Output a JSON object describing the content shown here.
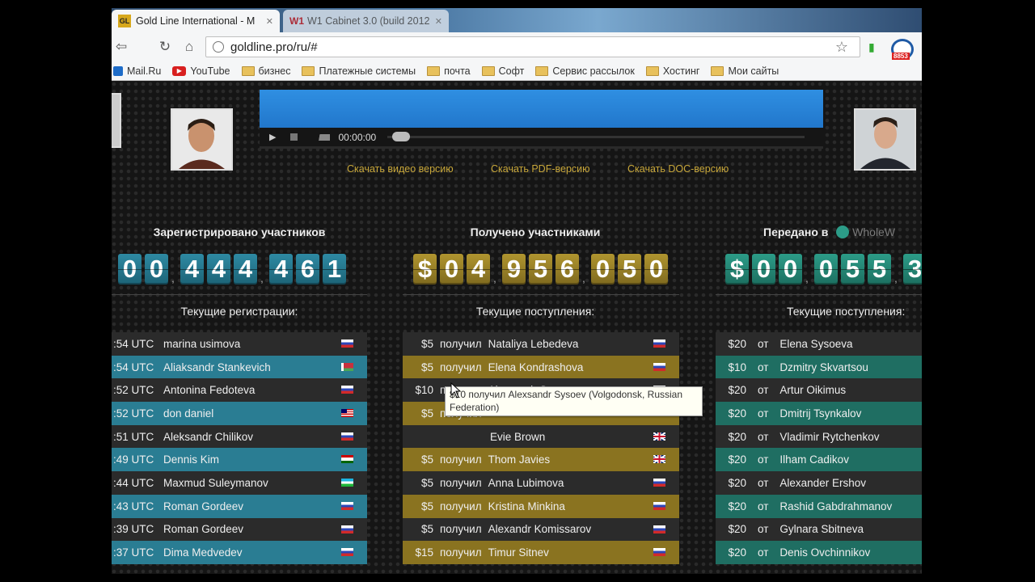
{
  "tabs": [
    {
      "title": "Gold Line International - M",
      "favicon": "GL"
    },
    {
      "title": "W1 Cabinet 3.0 (build 2012",
      "favicon": "W1"
    }
  ],
  "browser": {
    "url": "goldline.pro/ru/#",
    "ext_badge": "8853"
  },
  "bookmarks": [
    {
      "label": "Mail.Ru",
      "icon": "mail-icon"
    },
    {
      "label": "YouTube",
      "icon": "youtube-icon"
    },
    {
      "label": "бизнес",
      "icon": "folder-icon"
    },
    {
      "label": "Платежные системы",
      "icon": "folder-icon"
    },
    {
      "label": "почта",
      "icon": "folder-icon"
    },
    {
      "label": "Софт",
      "icon": "folder-icon"
    },
    {
      "label": "Сервис рассылок",
      "icon": "folder-icon"
    },
    {
      "label": "Хостинг",
      "icon": "folder-icon"
    },
    {
      "label": "Мои сайты",
      "icon": "folder-icon"
    }
  ],
  "player": {
    "time": "00:00:00"
  },
  "downloads": [
    "Скачать видео версию",
    "Скачать PDF-версию",
    "Скачать DOC-версию"
  ],
  "stats": {
    "registered": {
      "title": "Зарегистрировано участников",
      "digits": [
        "0",
        "0",
        "4",
        "4",
        "4",
        "4",
        "6",
        "1"
      ],
      "subtitle": "Текущие регистрации:",
      "rows": [
        {
          "time": ":54 UTC",
          "name": "marina usimova",
          "flag": "ru"
        },
        {
          "time": ":54 UTC",
          "name": "Aliaksandr Stankevich",
          "flag": "by"
        },
        {
          "time": ":52 UTC",
          "name": "Antonina Fedoteva",
          "flag": "ru"
        },
        {
          "time": ":52 UTC",
          "name": "don daniel",
          "flag": "my"
        },
        {
          "time": ":51 UTC",
          "name": "Aleksandr Chilikov",
          "flag": "ru"
        },
        {
          "time": ":49 UTC",
          "name": "Dennis Kim",
          "flag": "tj"
        },
        {
          "time": ":44 UTC",
          "name": "Maxmud Suleymanov",
          "flag": "uz"
        },
        {
          "time": ":43 UTC",
          "name": "Roman Gordeev",
          "flag": "ru"
        },
        {
          "time": ":39 UTC",
          "name": "Roman Gordeev",
          "flag": "ru"
        },
        {
          "time": ":37 UTC",
          "name": "Dima Medvedev",
          "flag": "ru"
        }
      ]
    },
    "received": {
      "title": "Получено участниками",
      "currency": "$",
      "digits": [
        "0",
        "4",
        "9",
        "5",
        "6",
        "0",
        "5",
        "0"
      ],
      "subtitle": "Текущие поступления:",
      "verb": "получил",
      "rows": [
        {
          "amount": "$5",
          "name": "Nataliya Lebedeva",
          "flag": "ru"
        },
        {
          "amount": "$5",
          "name": "Elena Kondrashova",
          "flag": "ru"
        },
        {
          "amount": "$10",
          "name": "Alexsandr Sysoev",
          "flag": "ru"
        },
        {
          "amount": "$5",
          "name": "",
          "flag": ""
        },
        {
          "amount": "",
          "name": "Evie Brown",
          "flag": "gb"
        },
        {
          "amount": "$5",
          "name": "Thom Javies",
          "flag": "gb"
        },
        {
          "amount": "$5",
          "name": "Anna Lubimova",
          "flag": "ru"
        },
        {
          "amount": "$5",
          "name": "Kristina Minkina",
          "flag": "ru"
        },
        {
          "amount": "$5",
          "name": "Alexandr Komissarov",
          "flag": "ru"
        },
        {
          "amount": "$15",
          "name": "Timur Sitnev",
          "flag": "ru"
        }
      ]
    },
    "transferred": {
      "title": "Передано в",
      "brand": "WholeW",
      "currency": "$",
      "digits": [
        "0",
        "0",
        "0",
        "5",
        "5",
        "3"
      ],
      "subtitle": "Текущие поступления:",
      "verb": "от",
      "rows": [
        {
          "amount": "$20",
          "name": "Elena Sysoeva"
        },
        {
          "amount": "$10",
          "name": "Dzmitry Skvartsou"
        },
        {
          "amount": "$20",
          "name": "Artur Oikimus"
        },
        {
          "amount": "$20",
          "name": "Dmitrij Tsynkalov"
        },
        {
          "amount": "$20",
          "name": "Vladimir Rytchenkov"
        },
        {
          "amount": "$20",
          "name": "Ilham Cadikov"
        },
        {
          "amount": "$20",
          "name": "Alexander Ershov"
        },
        {
          "amount": "$20",
          "name": "Rashid Gabdrahmanov"
        },
        {
          "amount": "$20",
          "name": "Gylnara Sbitneva"
        },
        {
          "amount": "$20",
          "name": "Denis Ovchinnikov"
        }
      ]
    }
  },
  "tooltip": {
    "line1": "$10 получил Alexsandr Sysoev (Volgodonsk, Russian",
    "line2": "Federation)"
  },
  "colors": {
    "teal": "#2a7d93",
    "gold": "#8a7320",
    "green": "#1f6e62",
    "link": "#c8a73a"
  }
}
